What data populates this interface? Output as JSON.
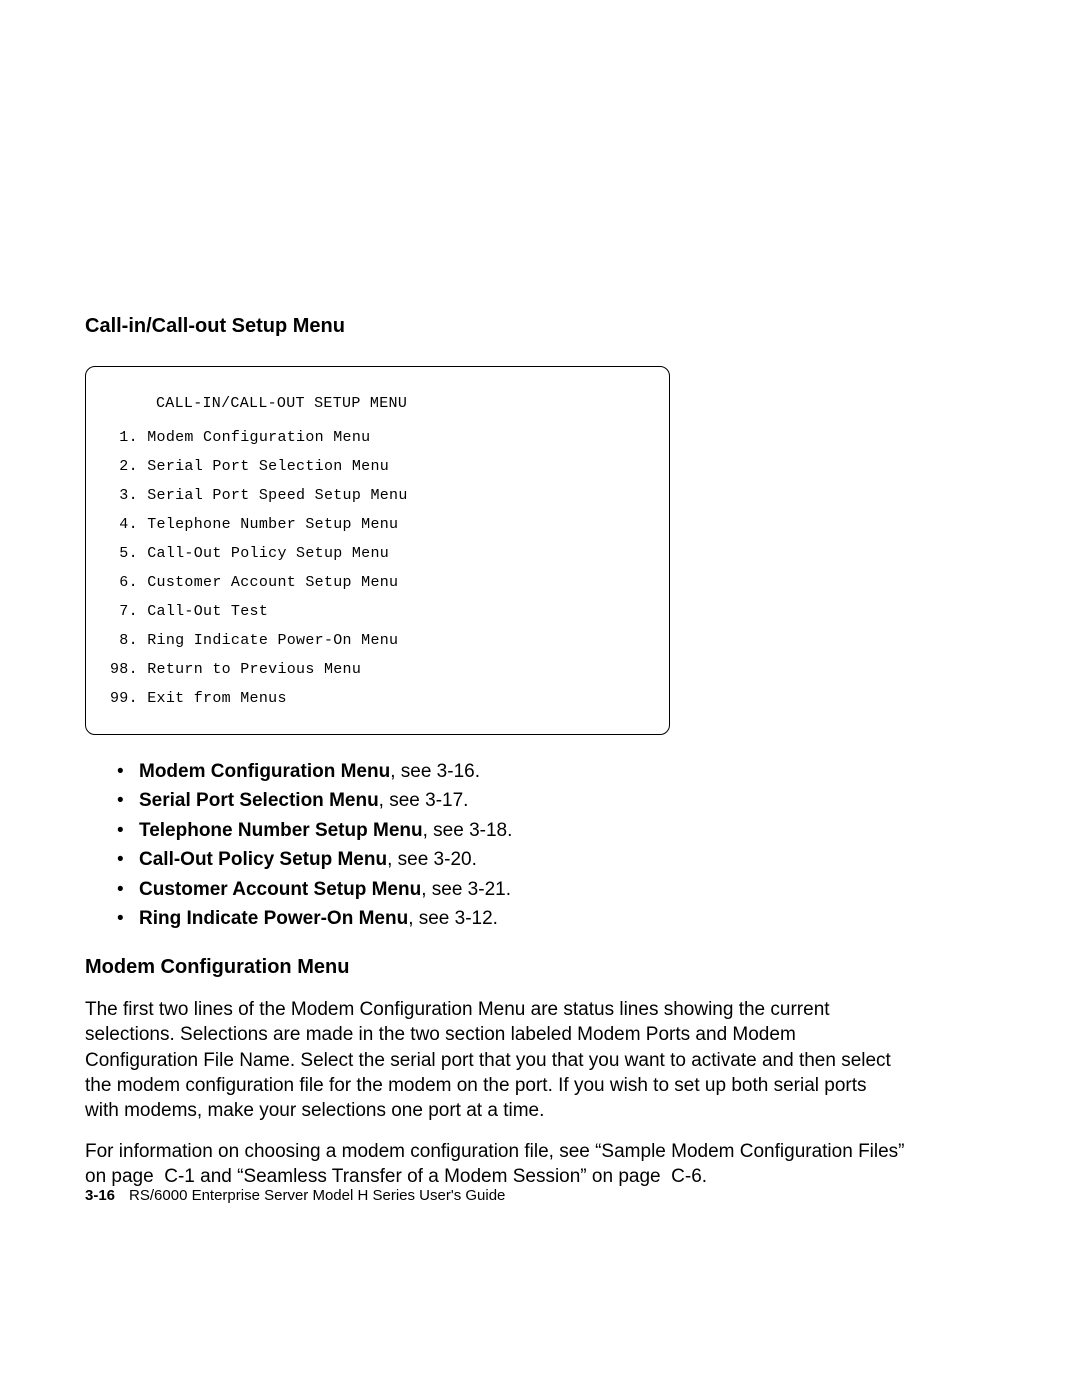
{
  "heading1": "Call-in/Call-out Setup Menu",
  "menu": {
    "title": "CALL-IN/CALL-OUT SETUP MENU",
    "items": [
      {
        "num": " 1.",
        "text": "Modem Configuration Menu"
      },
      {
        "num": " 2.",
        "text": "Serial Port Selection Menu"
      },
      {
        "num": " 3.",
        "text": "Serial Port Speed Setup Menu"
      },
      {
        "num": " 4.",
        "text": "Telephone Number Setup Menu"
      },
      {
        "num": " 5.",
        "text": "Call-Out Policy Setup Menu"
      },
      {
        "num": " 6.",
        "text": "Customer Account Setup Menu"
      },
      {
        "num": " 7.",
        "text": "Call-Out Test"
      },
      {
        "num": " 8.",
        "text": "Ring Indicate Power-On Menu"
      },
      {
        "num": "98.",
        "text": "Return to Previous Menu"
      },
      {
        "num": "99.",
        "text": "Exit from Menus"
      }
    ]
  },
  "bullets": [
    {
      "bold": "Modem Configuration Menu",
      "rest": ", see 3-16."
    },
    {
      "bold": "Serial Port Selection Menu",
      "rest": ", see 3-17."
    },
    {
      "bold": "Telephone Number Setup Menu",
      "rest": ", see 3-18."
    },
    {
      "bold": "Call-Out Policy Setup Menu",
      "rest": ", see 3-20."
    },
    {
      "bold": "Customer Account Setup Menu",
      "rest": ", see 3-21."
    },
    {
      "bold": "Ring Indicate Power-On Menu",
      "rest": ", see 3-12."
    }
  ],
  "heading2": "Modem Configuration Menu",
  "para1": "The first two lines of the Modem Configuration Menu are status lines showing the current selections. Selections are made in the two section labeled Modem Ports and Modem Configuration File Name. Select the serial port that you that you want to activate and then select the modem configuration file for the modem on the port. If you wish to set up both serial ports with modems, make your selections one port at a time.",
  "para2": "For information on choosing a modem configuration file, see “Sample Modem Configuration Files” on page  C-1 and “Seamless Transfer of a Modem Session” on page  C-6.",
  "footer": {
    "page_num": "3-16",
    "title": "RS/6000 Enterprise Server Model H Series User's Guide"
  }
}
